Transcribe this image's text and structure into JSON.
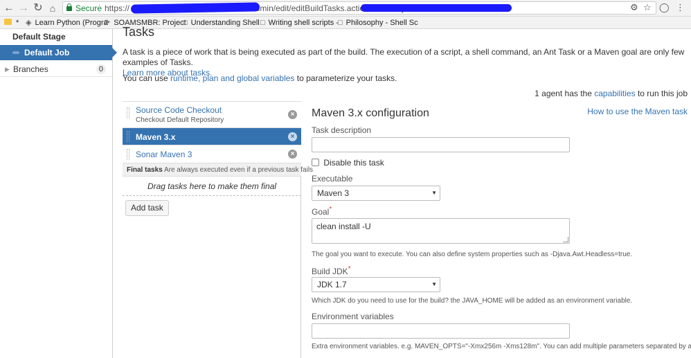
{
  "browser": {
    "secure_label": "Secure",
    "url_prefix": "https://",
    "url_middle": "/build/admin/edit/editBuildTasks.action?buildKey=",
    "bookmarks": [
      {
        "label": "Learn Python (Progra"
      },
      {
        "label": "SOAMSMBR: Project"
      },
      {
        "label": "Understanding Shell"
      },
      {
        "label": "Writing shell scripts -"
      },
      {
        "label": "Philosophy - Shell Sc"
      }
    ]
  },
  "sidebar": {
    "stage_label": "Default Stage",
    "job_label": "Default Job",
    "branches_label": "Branches",
    "branches_count": "0"
  },
  "main": {
    "title": "Tasks",
    "intro_text": "A task is a piece of work that is being executed as part of the build. The execution of a script, a shell command, an Ant Task or a Maven goal are only few examples of Tasks.",
    "learn_more_link": "Learn more about tasks.",
    "variables_prefix": "You can use",
    "variables_link": "runtime, plan and global variables",
    "variables_suffix": "to parameterize your tasks.",
    "agents_prefix": "1 agent has the",
    "agents_link": "capabilities",
    "agents_suffix": "to run this job"
  },
  "tasks": {
    "items": [
      {
        "name": "Source Code Checkout",
        "subtitle": "Checkout Default Repository"
      },
      {
        "name": "Maven 3.x",
        "subtitle": ""
      },
      {
        "name": "Sonar Maven 3",
        "subtitle": ""
      }
    ],
    "final_title": "Final tasks",
    "final_desc": "Are always executed even if a previous task fails",
    "dropzone_text": "Drag tasks here to make them final",
    "add_task_label": "Add task"
  },
  "config": {
    "title": "Maven 3.x configuration",
    "howto_link": "How to use the Maven task",
    "task_description_label": "Task description",
    "task_description_value": "",
    "disable_label": "Disable this task",
    "executable_label": "Executable",
    "executable_value": "Maven 3",
    "goal_label": "Goal",
    "goal_value": "clean install -U",
    "goal_help": "The goal you want to execute. You can also define system properties such as -Djava.Awt.Headless=true.",
    "jdk_label": "Build JDK",
    "jdk_value": "JDK 1.7",
    "jdk_help": "Which JDK do you need to use for the build? the JAVA_HOME will be added as an environment variable.",
    "env_label": "Environment variables",
    "env_value": "",
    "env_help": "Extra environment variables. e.g. MAVEN_OPTS=\"-Xmx256m -Xms128m\". You can add multiple parameters separated by a space.",
    "required_mark": "*"
  },
  "colors": {
    "accent": "#3572b0",
    "required": "#d04437",
    "secure": "#188038"
  }
}
